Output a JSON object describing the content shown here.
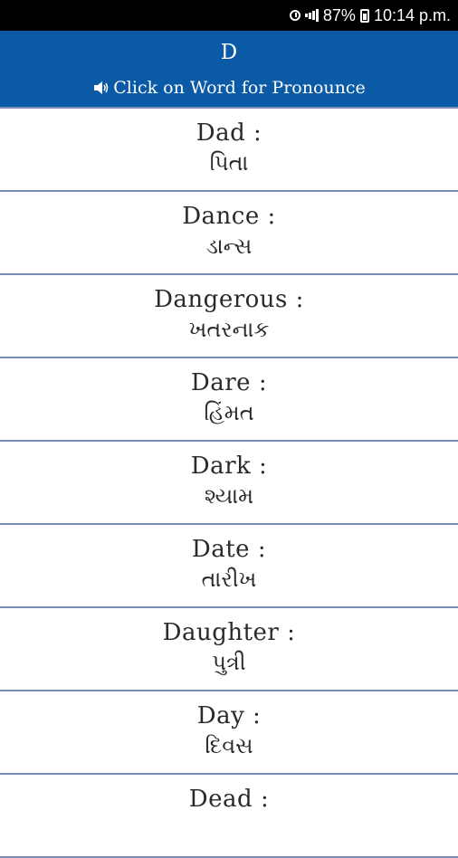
{
  "status_bar": {
    "battery": "87%",
    "time": "10:14 p.m.",
    "icons": [
      "alarm-icon",
      "signal-icon",
      "battery-icon"
    ]
  },
  "header": {
    "letter": "D",
    "hint": "Click on Word for Pronounce",
    "hint_icon": "speaker-icon",
    "background": "#0a5aa6"
  },
  "words": [
    {
      "word": "Dad :",
      "meaning": "પિતા"
    },
    {
      "word": "Dance :",
      "meaning": "ડાન્સ"
    },
    {
      "word": "Dangerous :",
      "meaning": "ખતરનાક"
    },
    {
      "word": "Dare :",
      "meaning": "હિંમત"
    },
    {
      "word": "Dark :",
      "meaning": "શ્યામ"
    },
    {
      "word": "Date :",
      "meaning": "તારીખ"
    },
    {
      "word": "Daughter :",
      "meaning": "પુત્રી"
    },
    {
      "word": "Day :",
      "meaning": "દિવસ"
    },
    {
      "word": "Dead :",
      "meaning": ""
    }
  ]
}
